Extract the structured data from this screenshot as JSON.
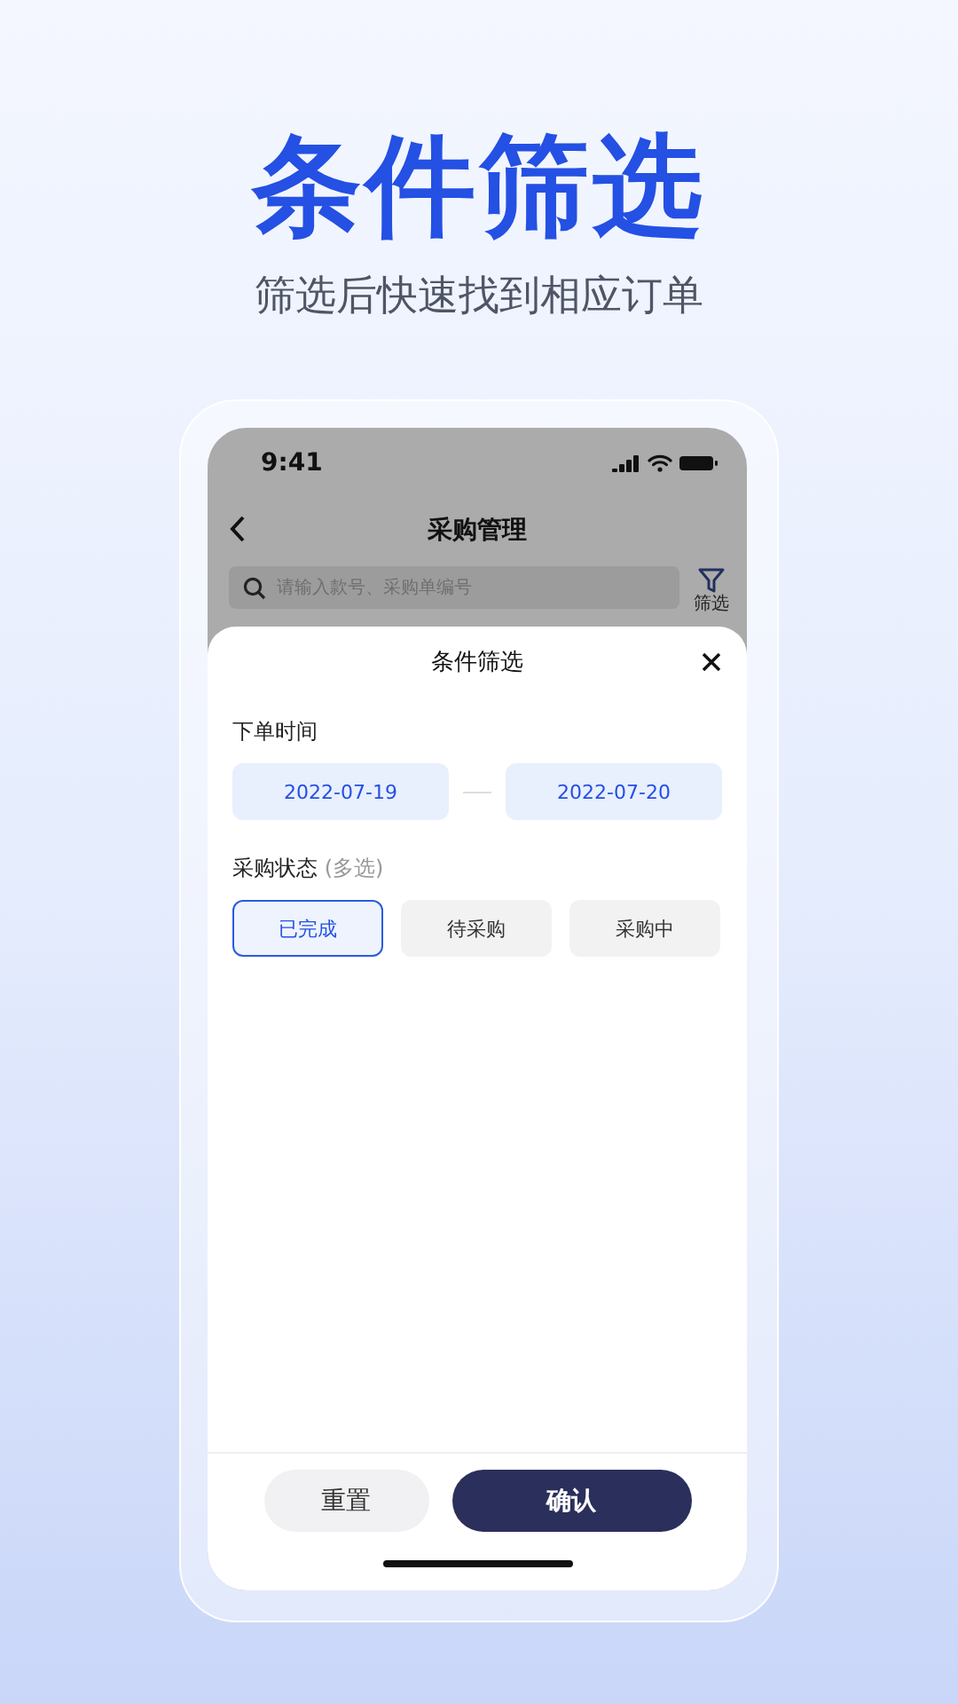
{
  "hero": {
    "title": "条件筛选",
    "subtitle": "筛选后快速找到相应订单"
  },
  "status_bar": {
    "time": "9:41"
  },
  "nav": {
    "title": "采购管理"
  },
  "search": {
    "placeholder": "请输入款号、采购单编号"
  },
  "filter_button": {
    "label": "筛选"
  },
  "sheet": {
    "title": "条件筛选",
    "sections": [
      {
        "kind": "date_range",
        "label": "下单时间",
        "start": "2022-07-19",
        "end": "2022-07-20"
      },
      {
        "kind": "chips",
        "label": "采购状态",
        "note": "(多选)",
        "options": [
          {
            "label": "已完成",
            "selected": true
          },
          {
            "label": "待采购",
            "selected": false
          },
          {
            "label": "采购中",
            "selected": false
          }
        ]
      }
    ]
  },
  "buttons": [
    {
      "kind": "secondary",
      "label": "重置"
    },
    {
      "kind": "primary",
      "label": "确认"
    }
  ]
}
